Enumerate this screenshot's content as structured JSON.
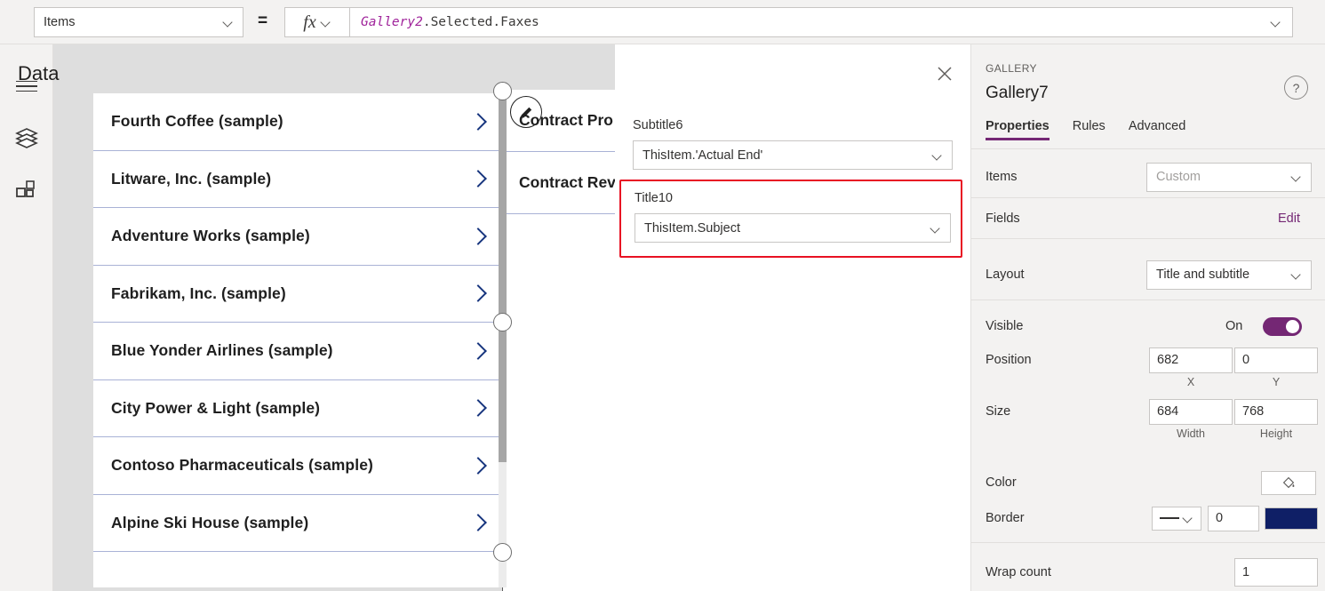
{
  "formula_bar": {
    "property_select": "Items",
    "equals": "=",
    "fx_label": "fx",
    "formula_object": "Gallery2",
    "formula_rest": ".Selected.Faxes"
  },
  "left_rail": {
    "items": [
      {
        "name": "hamburger-menu-icon",
        "label": "Menu"
      },
      {
        "name": "tree-view-icon",
        "label": "Tree view"
      },
      {
        "name": "insert-icon",
        "label": "Insert"
      }
    ]
  },
  "canvas": {
    "left_gallery": {
      "items": [
        "Fourth Coffee (sample)",
        "Litware, Inc. (sample)",
        "Adventure Works (sample)",
        "Fabrikam, Inc. (sample)",
        "Blue Yonder Airlines (sample)",
        "City Power & Light (sample)",
        "Contoso Pharmaceuticals (sample)",
        "Alpine Ski House (sample)"
      ]
    },
    "right_gallery": {
      "items": [
        "Contract Pro",
        "Contract Rev"
      ],
      "edit_badge": "edit-pencil-icon"
    }
  },
  "data_panel": {
    "title": "Data",
    "close_label": "Close",
    "fields": [
      {
        "label": "Subtitle6",
        "value": "ThisItem.'Actual End'",
        "highlighted": false
      },
      {
        "label": "Title10",
        "value": "ThisItem.Subject",
        "highlighted": true
      }
    ]
  },
  "properties_panel": {
    "kicker": "GALLERY",
    "name": "Gallery7",
    "help": "?",
    "tabs": [
      {
        "label": "Properties",
        "active": true
      },
      {
        "label": "Rules",
        "active": false
      },
      {
        "label": "Advanced",
        "active": false
      }
    ],
    "items_row": {
      "label": "Items",
      "value": "Custom"
    },
    "fields_row": {
      "label": "Fields",
      "action": "Edit"
    },
    "layout_row": {
      "label": "Layout",
      "value": "Title and subtitle"
    },
    "visible_row": {
      "label": "Visible",
      "state": "On"
    },
    "position_row": {
      "label": "Position",
      "x": "682",
      "y": "0",
      "x_sub": "X",
      "y_sub": "Y"
    },
    "size_row": {
      "label": "Size",
      "width": "684",
      "height": "768",
      "width_sub": "Width",
      "height_sub": "Height"
    },
    "color_row": {
      "label": "Color",
      "swatch_icon": "paint-bucket-icon"
    },
    "border_row": {
      "label": "Border",
      "style": "solid-line",
      "width": "0",
      "color": "#0f1f66"
    },
    "wrap_row": {
      "label": "Wrap count",
      "value": "1"
    }
  },
  "colors": {
    "accent_purple": "#742774",
    "highlight_red": "#e81123",
    "chevron_navy": "#17357e",
    "separator_lavender": "#a9b2d6",
    "border_navy": "#0f1f66"
  }
}
